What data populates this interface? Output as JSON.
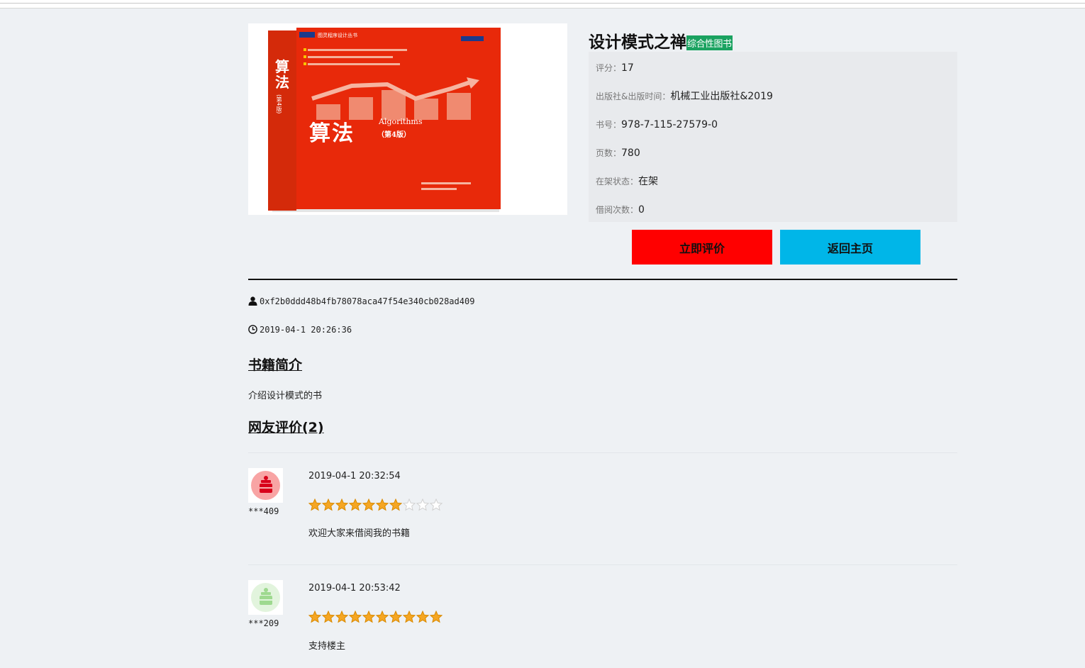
{
  "book": {
    "title": "设计模式之禅",
    "category_tag": "综合性图书",
    "cover": {
      "spine_title": "算法",
      "spine_edition": "(第4版)",
      "series": "图灵程序设计丛书",
      "main_title": "算法",
      "subtitle": "Algorithms",
      "edition": "（第4版）"
    },
    "fields": [
      {
        "label": "评分：",
        "value": "17"
      },
      {
        "label": "出版社&出版时间：",
        "value": "机械工业出版社&2019"
      },
      {
        "label": "书号：",
        "value": "978-7-115-27579-0"
      },
      {
        "label": "页数：",
        "value": "780"
      },
      {
        "label": "在架状态：",
        "value": "在架"
      },
      {
        "label": "借阅次数：",
        "value": "0"
      }
    ]
  },
  "actions": {
    "review_label": "立即评价",
    "home_label": "返回主页"
  },
  "owner": {
    "address": "0xf2b0ddd48b4fb78078aca47f54e340cb028ad409",
    "time": "2019-04-1 20:26:36"
  },
  "intro": {
    "heading": "书籍简介",
    "text": "介绍设计模式的书"
  },
  "reviews": {
    "heading": "网友评价(2)",
    "items": [
      {
        "user": "***409",
        "time": "2019-04-1 20:32:54",
        "rating": 7,
        "max": 10,
        "text": "欢迎大家来借阅我的书籍",
        "avatar_color": "#f25a5a"
      },
      {
        "user": "***209",
        "time": "2019-04-1 20:53:42",
        "rating": 10,
        "max": 10,
        "text": "支持楼主",
        "avatar_color": "#9ed98f"
      }
    ]
  },
  "colors": {
    "review_button": "#ff0000",
    "home_button": "#00b6e8",
    "tag": "#1aa260",
    "star_on": "#f5a623",
    "star_off": "#d0d0d0"
  }
}
